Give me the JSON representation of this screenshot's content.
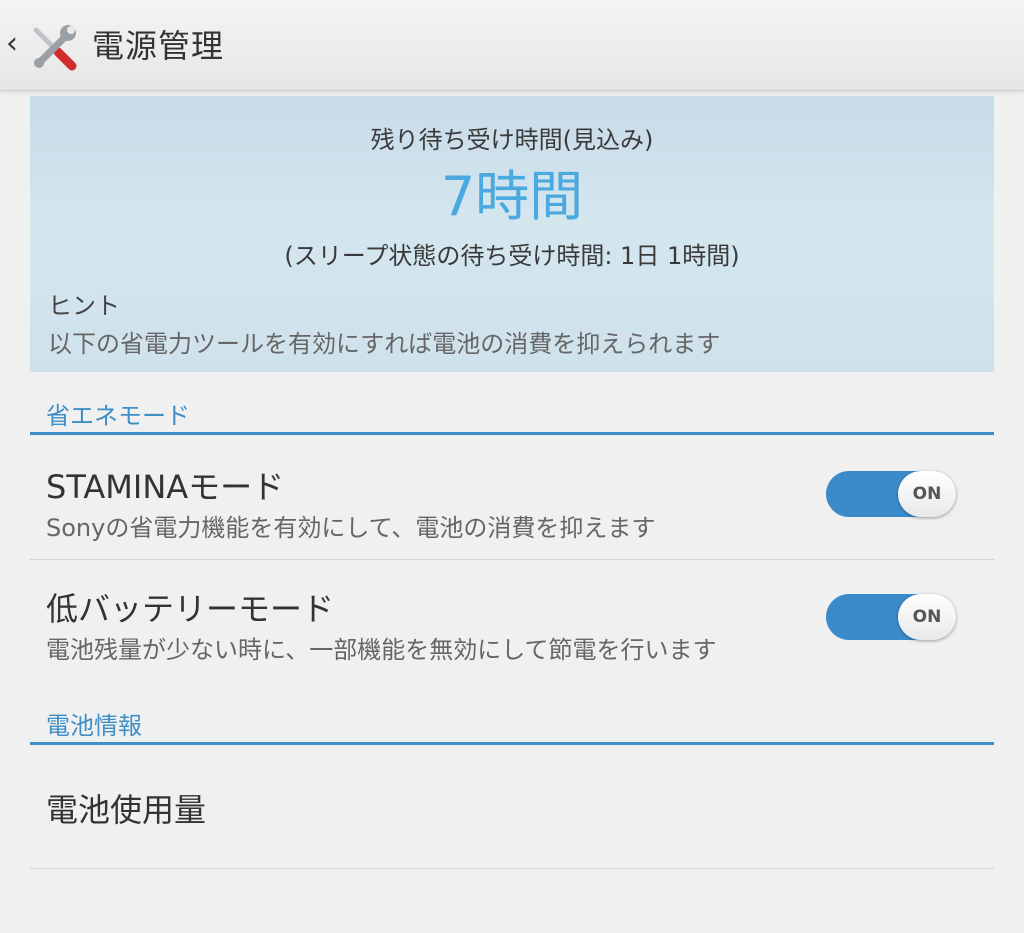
{
  "header": {
    "back_icon": "chevron-left-icon",
    "app_icon": "tools-icon",
    "title": "電源管理"
  },
  "estimate": {
    "label": "残り待ち受け時間(見込み)",
    "value": "7時間",
    "sleep_text": "(スリープ状態の待ち受け時間: 1日 1時間)",
    "hint_title": "ヒント",
    "hint_text": "以下の省電力ツールを有効にすれば電池の消費を抑えられます",
    "value_color": "#4aa9df"
  },
  "sections": {
    "eco": {
      "header": "省エネモード",
      "stamina": {
        "title": "STAMINAモード",
        "subtitle": "Sonyの省電力機能を有効にして、電池の消費を抑えます",
        "toggle": "ON"
      },
      "low_battery": {
        "title": "低バッテリーモード",
        "subtitle": "電池残量が少ない時に、一部機能を無効にして節電を行います",
        "toggle": "ON"
      }
    },
    "battery_info": {
      "header": "電池情報",
      "usage": {
        "title": "電池使用量"
      }
    }
  },
  "colors": {
    "accent": "#3d8fc6",
    "toggle_on": "#3b8bcb"
  }
}
